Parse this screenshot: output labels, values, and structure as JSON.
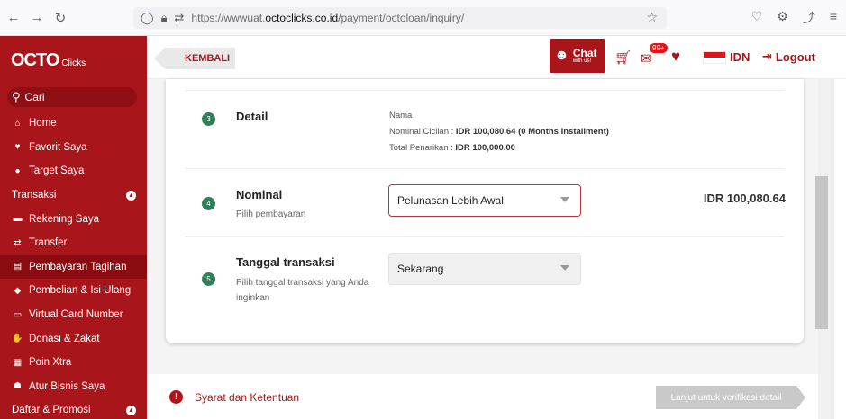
{
  "browser": {
    "url_prefix": "https://wwwuat.",
    "url_domain": "octoclicks.co.id",
    "url_path": "/payment/octoloan/inquiry/"
  },
  "sidebar": {
    "logo_main": "OCTO",
    "logo_sub": "Clicks",
    "search_placeholder": "Cari",
    "items": [
      {
        "label": "Home",
        "icon": "home-icon",
        "glyph": "⌂"
      },
      {
        "label": "Favorit Saya",
        "icon": "heart-icon",
        "glyph": "♥"
      },
      {
        "label": "Target Saya",
        "icon": "location-pin-icon",
        "glyph": "●"
      },
      {
        "label": "Transaksi",
        "section": true
      },
      {
        "label": "Rekening Saya",
        "icon": "card-icon",
        "glyph": "▬"
      },
      {
        "label": "Transfer",
        "icon": "transfer-icon",
        "glyph": "⇄"
      },
      {
        "label": "Pembayaran Tagihan",
        "icon": "bill-icon",
        "glyph": "▤",
        "active": true
      },
      {
        "label": "Pembelian & Isi Ulang",
        "icon": "tag-icon",
        "glyph": "◆"
      },
      {
        "label": "Virtual Card Number",
        "icon": "virtual-card-icon",
        "glyph": "▭"
      },
      {
        "label": "Donasi & Zakat",
        "icon": "donation-icon",
        "glyph": "✋"
      },
      {
        "label": "Poin Xtra",
        "icon": "gift-icon",
        "glyph": "▦"
      },
      {
        "label": "Atur Bisnis Saya",
        "icon": "business-icon",
        "glyph": "☗"
      },
      {
        "label": "Daftar & Promosi",
        "section": true
      }
    ]
  },
  "header": {
    "back_label": "KEMBALI",
    "chat_label": "Chat",
    "chat_sub": "with us!",
    "notification_badge": "99+",
    "language": "IDN",
    "logout_label": "Logout"
  },
  "form": {
    "detail": {
      "step": "3",
      "title": "Detail",
      "nama_label": "Nama",
      "cicilan_label": "Nominal Cicilan :",
      "cicilan_value": "IDR 100,080.64 (0 Months Installment)",
      "penarikan_label": "Total Penarikan :",
      "penarikan_value": "IDR 100,000.00"
    },
    "nominal": {
      "step": "4",
      "title": "Nominal",
      "subtitle": "Pilih pembayaran",
      "selected": "Pelunasan Lebih Awal",
      "amount": "IDR 100,080.64"
    },
    "tanggal": {
      "step": "5",
      "title": "Tanggal transaksi",
      "subtitle": "Pilih tanggal transaksi yang Anda inginkan",
      "selected": "Sekarang"
    }
  },
  "footer": {
    "terms_label": "Syarat dan Ketentuan",
    "next_label": "Lanjut untuk verifikasi detail"
  },
  "colors": {
    "brand_red": "#a8161b",
    "step_green": "#2f7f5b"
  }
}
